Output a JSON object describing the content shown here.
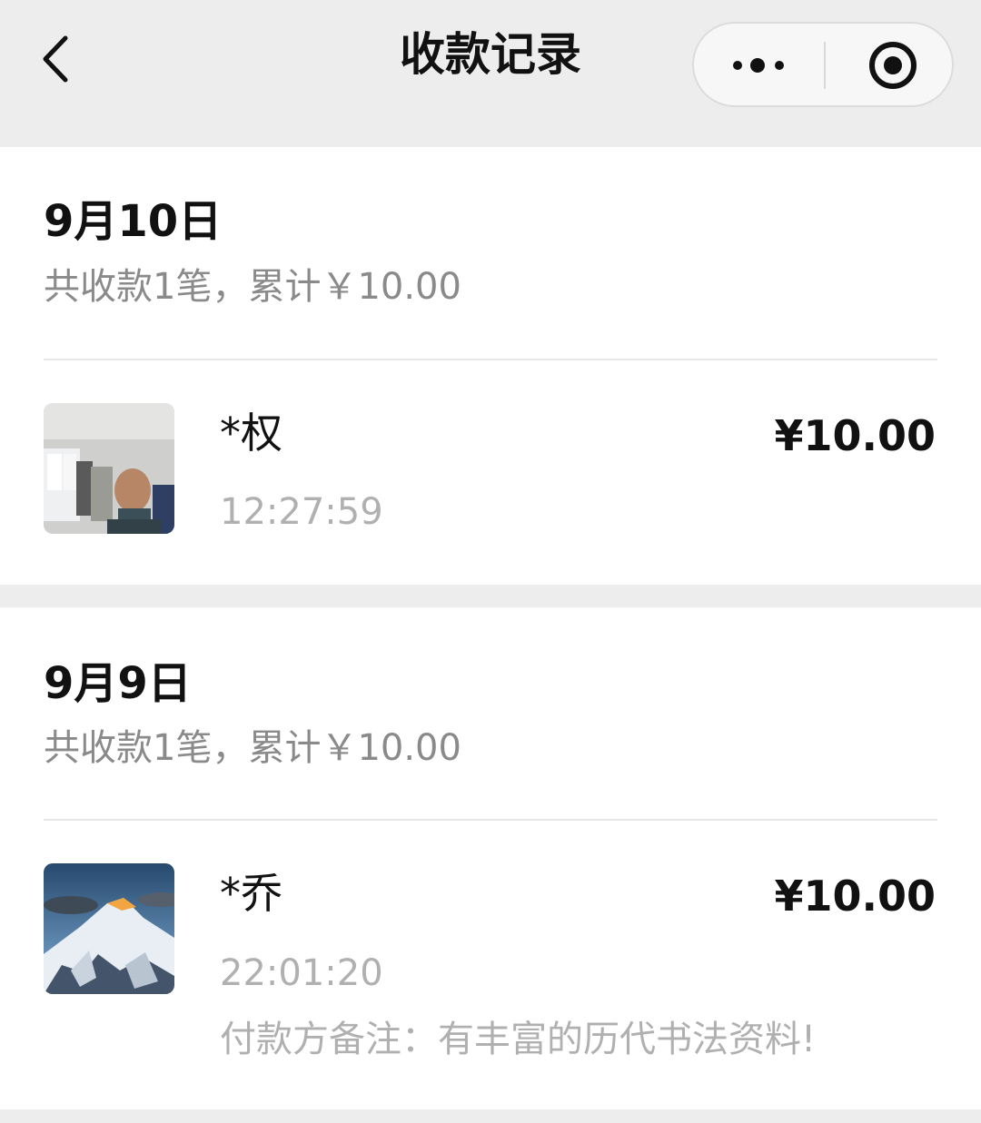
{
  "header": {
    "title": "收款记录",
    "back_icon": "chevron-left-icon",
    "more_icon": "more-dots-icon",
    "close_icon": "target-close-icon"
  },
  "groups": [
    {
      "date": "9月10日",
      "summary": "共收款1笔，累计￥10.00",
      "records": [
        {
          "payer": "*权",
          "amount": "¥10.00",
          "time": "12:27:59",
          "avatar": "avatar-photo-man"
        }
      ]
    },
    {
      "date": "9月9日",
      "summary": "共收款1笔，累计￥10.00",
      "records": [
        {
          "payer": "*乔",
          "amount": "¥10.00",
          "time": "22:01:20",
          "remark": "付款方备注：有丰富的历代书法资料!",
          "avatar": "avatar-photo-mountain"
        }
      ]
    }
  ]
}
